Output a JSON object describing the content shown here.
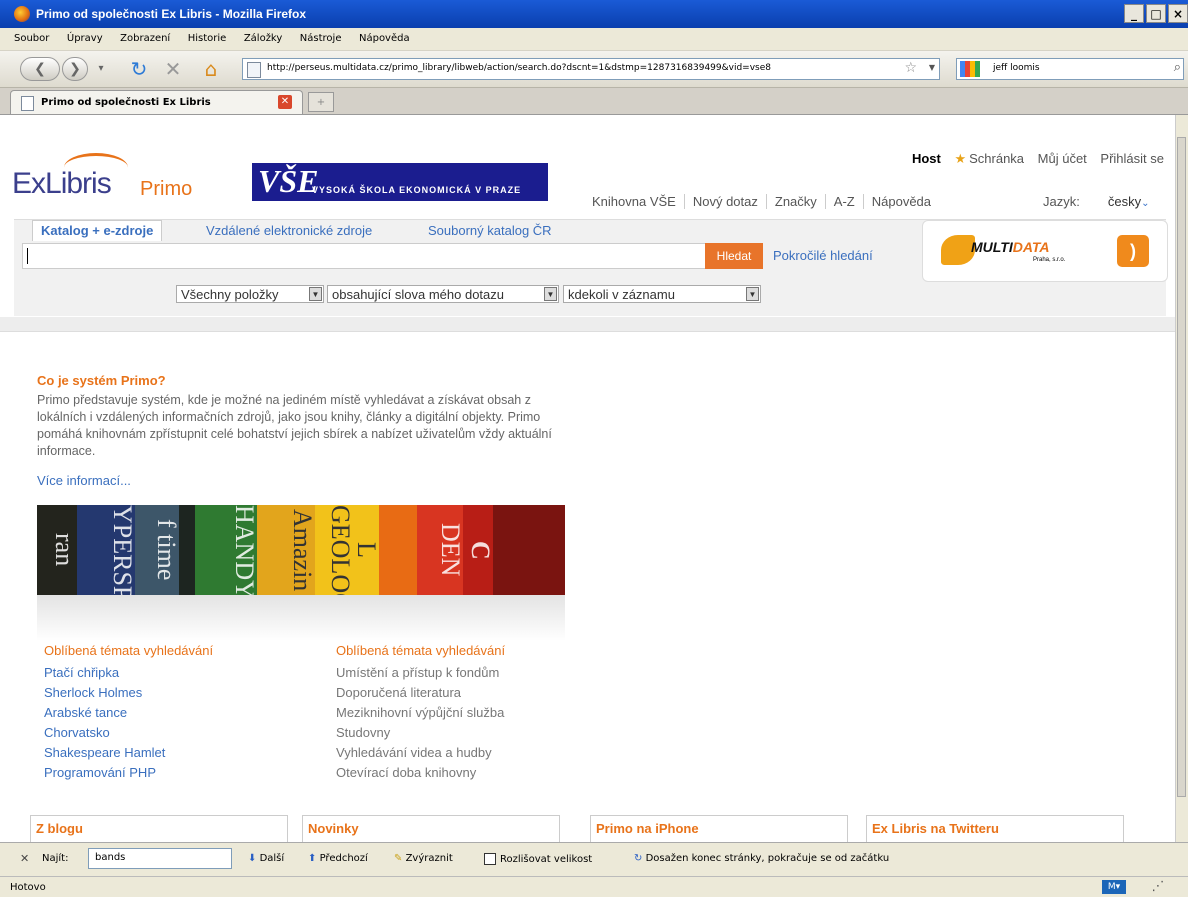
{
  "window": {
    "title": "Primo od společnosti Ex Libris - Mozilla Firefox",
    "buttons": [
      "_",
      "□",
      "×"
    ]
  },
  "menu": [
    "Soubor",
    "Úpravy",
    "Zobrazení",
    "Historie",
    "Záložky",
    "Nástroje",
    "Nápověda"
  ],
  "nav": {
    "url": "http://perseus.multidata.cz/primo_library/libweb/action/search.do?dscnt=1&dstmp=1287316839499&vid=vse8",
    "search_value": "jeff loomis"
  },
  "tab": {
    "label": "Primo od společnosti Ex Libris",
    "new_tab": "+"
  },
  "page": {
    "top_links": {
      "host": "Host",
      "basket": "Schránka",
      "account": "Můj účet",
      "login": "Přihlásit se"
    },
    "logo": {
      "exlibris": "ExLibris",
      "primo": "Primo",
      "vse_big": "VŠE",
      "vse_text": "VYSOKÁ ŠKOLA EKONOMICKÁ V PRAZE"
    },
    "site_links": [
      "Knihovna VŠE",
      "Nový dotaz",
      "Značky",
      "A-Z",
      "Nápověda"
    ],
    "language": {
      "label": "Jazyk:",
      "value": "česky"
    },
    "search_tabs": [
      "Katalog + e-zdroje",
      "Vzdálené elektronické zdroje",
      "Souborný katalog ČR"
    ],
    "search_button": "Hledat",
    "advanced_search": "Pokročilé hledání",
    "promo": {
      "brand1": "MULTI",
      "brand2": "DATA",
      "brand_sub": "Praha, s.r.o."
    },
    "dropdowns": [
      "Všechny položky",
      "obsahující slova mého dotazu",
      "kdekoli v záznamu"
    ],
    "about": {
      "title": "Co je systém Primo?",
      "text": "Primo představuje systém, kde je možné na jediném místě vyhledávat a získávat obsah z lokálních i vzdálených informačních zdrojů, jako jsou knihy, články a digitální objekty. Primo pomáhá knihovnám zpřístupnit celé bohatství jejich sbírek a nabízet uživatelům vždy aktuální informace.",
      "more": "Více informací..."
    },
    "book_spines": [
      "ran",
      "YPERSPA",
      "f time",
      "HANDY",
      "Amazin",
      "L GEOLOGIS",
      "DEN",
      "C"
    ],
    "popular_left": {
      "title": "Oblíbená témata vyhledávání",
      "items": [
        "Ptačí chřipka",
        "Sherlock Holmes",
        "Arabské tance",
        "Chorvatsko",
        "Shakespeare Hamlet",
        "Programování PHP"
      ]
    },
    "popular_right": {
      "title": "Oblíbená témata vyhledávání",
      "items": [
        "Umístění a přístup k fondům",
        "Doporučená literatura",
        "Meziknihovní výpůjční služba",
        "Studovny",
        "Vyhledávání videa a hudby",
        "Otevírací doba knihovny"
      ]
    },
    "boxes": [
      "Z blogu",
      "Novinky",
      "Primo na iPhone",
      "Ex Libris na Twitteru"
    ]
  },
  "findbar": {
    "label": "Najít:",
    "value": "bands",
    "next": "Další",
    "prev": "Předchozí",
    "highlight": "Zvýraznit",
    "match_case": "Rozlišovat velikost",
    "message": "Dosažen konec stránky, pokračuje se od začátku"
  },
  "status": {
    "text": "Hotovo"
  },
  "colors": {
    "accent_orange": "#e8731a",
    "link_blue": "#3a6fbe",
    "vse_blue": "#1b1d8f",
    "titlebar": "#0a3fae"
  }
}
